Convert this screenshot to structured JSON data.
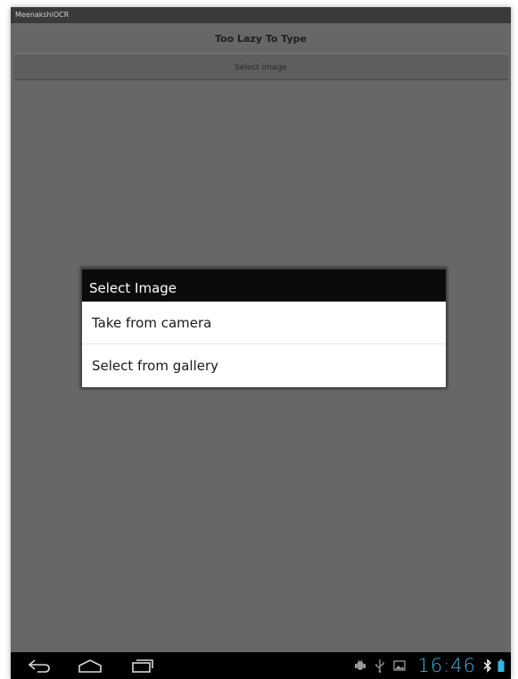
{
  "app": {
    "window_title": "MeenakshiOCR",
    "heading": "Too Lazy To Type",
    "select_image_button": "Select image"
  },
  "dialog": {
    "title": "Select Image",
    "options": [
      {
        "label": "Take from camera"
      },
      {
        "label": "Select from gallery"
      }
    ]
  },
  "system_bar": {
    "nav_icons": [
      "back-icon",
      "home-icon",
      "recent-apps-icon"
    ],
    "status_icons": [
      "android-debug-icon",
      "usb-icon",
      "gallery-notification-icon",
      "bluetooth-icon",
      "battery-icon"
    ],
    "clock": "16:46",
    "colors": {
      "clock": "#33b5e5",
      "background": "#000000"
    }
  },
  "colors": {
    "screen_background": "#676767",
    "dialog_title_background": "#0b0b0b",
    "dialog_body_background": "#ffffff"
  }
}
